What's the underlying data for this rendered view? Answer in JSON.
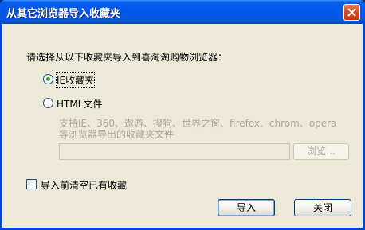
{
  "dialog": {
    "title": "从其它浏览器导入收藏夹",
    "close_icon": "close-icon"
  },
  "prompt": "请选择从以下收藏夹导入到喜淘淘购物浏览器：",
  "options": {
    "ie": {
      "label": "IE收藏夹",
      "selected": true
    },
    "html": {
      "label": "HTML文件",
      "selected": false
    }
  },
  "hint": {
    "line1": "支持IE、360、遨游、搜狗、世界之窗、firefox、chrom、opera",
    "line2": "等浏览器导出的收藏夹文件"
  },
  "file_path": {
    "value": "",
    "enabled": false
  },
  "browse_label": "浏览...",
  "clear_existing": {
    "label": "导入前清空已有收藏",
    "checked": false
  },
  "buttons": {
    "import_label": "导入",
    "close_label": "关闭"
  },
  "colors": {
    "titlebar": "#0058ee",
    "dialog_bg": "#ece9d8",
    "disabled_text": "#aca899",
    "radio_dot": "#2f9d2c",
    "close_button": "#d8461c"
  }
}
